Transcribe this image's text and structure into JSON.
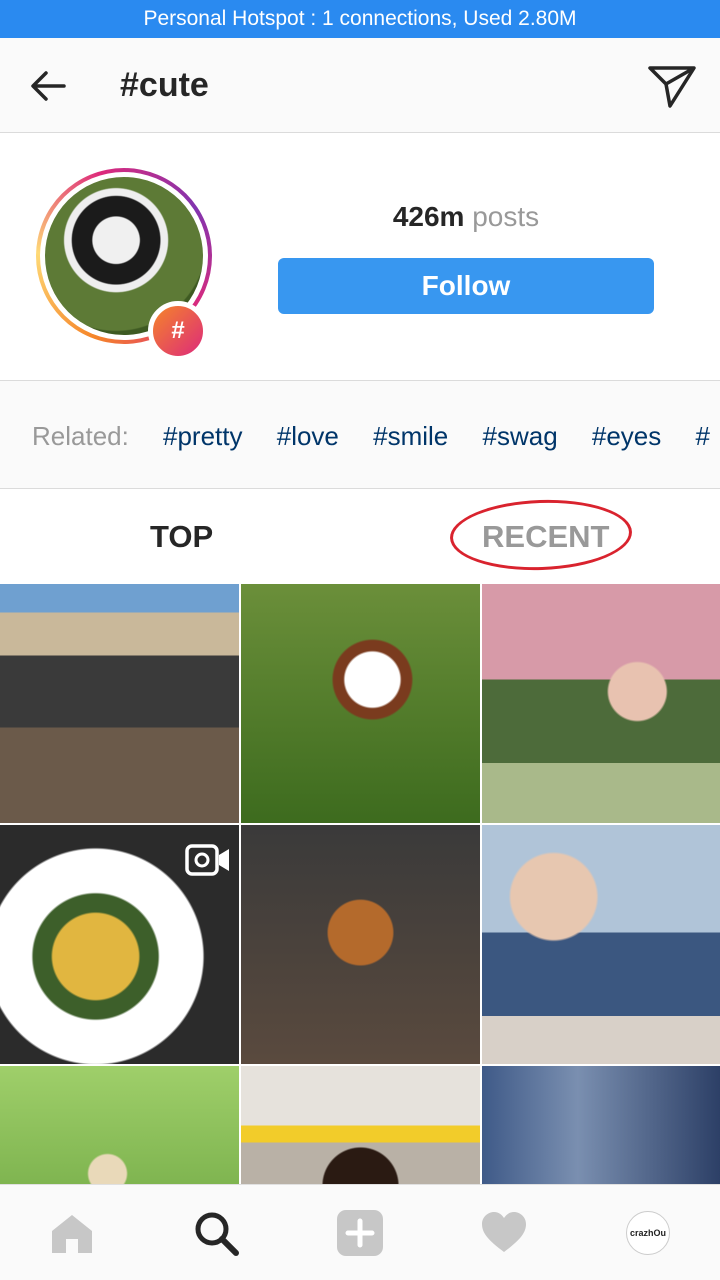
{
  "status_bar": {
    "text": "Personal Hotspot : 1 connections, Used 2.80M"
  },
  "appbar": {
    "title": "#cute",
    "back_icon": "arrow-left-icon",
    "direct_icon": "paper-plane-icon"
  },
  "header": {
    "badge_symbol": "#",
    "post_count": "426m",
    "post_unit": "posts",
    "follow_label": "Follow"
  },
  "related": {
    "label": "Related:",
    "tags": [
      "#pretty",
      "#love",
      "#smile",
      "#swag",
      "#eyes",
      "#"
    ]
  },
  "tabs": {
    "top_label": "TOP",
    "recent_label": "RECENT"
  },
  "colors": {
    "accent": "#3897f0",
    "hotspot": "#2a8af0",
    "tag": "#003569",
    "annotation": "#d9232e"
  },
  "bottom_nav": {
    "icons": [
      "home-icon",
      "search-icon",
      "add-post-icon",
      "heart-icon",
      "profile-avatar"
    ],
    "profile_text": "crazhOu"
  }
}
